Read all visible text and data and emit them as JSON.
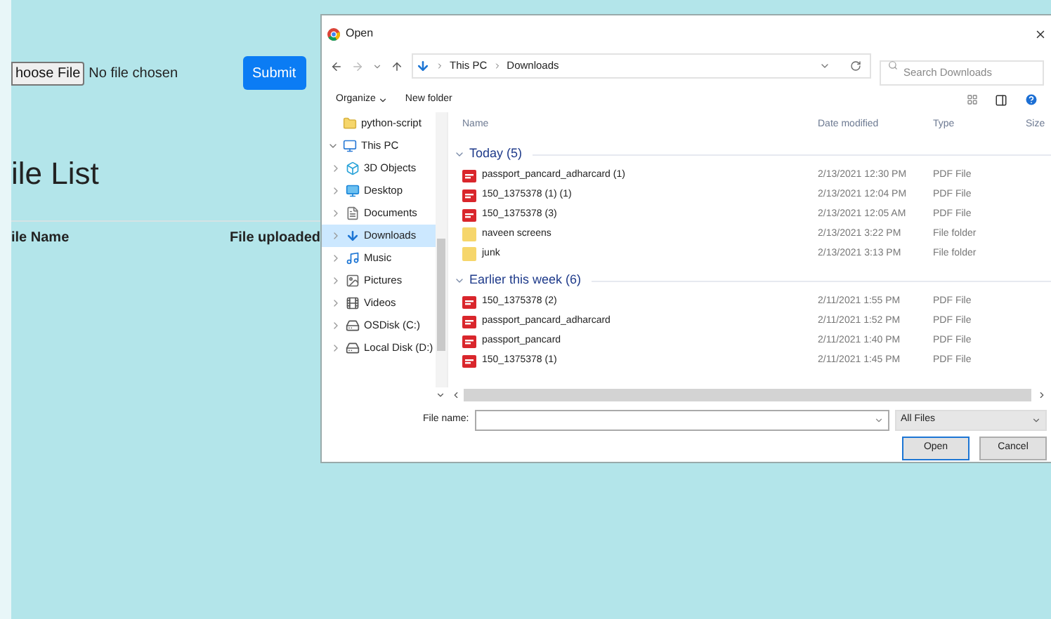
{
  "page": {
    "file_input": {
      "button": "hoose File",
      "status": "No file chosen"
    },
    "submit": "Submit",
    "heading": "ile List",
    "table": {
      "columns": [
        "ile Name",
        "File uploaded"
      ]
    }
  },
  "dialog": {
    "title": "Open",
    "address": {
      "path": [
        "This PC",
        "Downloads"
      ]
    },
    "search": {
      "placeholder": "Search Downloads"
    },
    "toolbar": {
      "organize": "Organize",
      "new_folder": "New folder"
    },
    "nav": [
      {
        "label": "python-script",
        "kind": "folder",
        "selected": false
      },
      {
        "label": "This PC",
        "kind": "pc",
        "selected": false,
        "expanded": true,
        "children": [
          {
            "label": "3D Objects",
            "kind": "objects",
            "selected": false
          },
          {
            "label": "Desktop",
            "kind": "desktop",
            "selected": false
          },
          {
            "label": "Documents",
            "kind": "documents",
            "selected": false
          },
          {
            "label": "Downloads",
            "kind": "downloads",
            "selected": true
          },
          {
            "label": "Music",
            "kind": "music",
            "selected": false
          },
          {
            "label": "Pictures",
            "kind": "pictures",
            "selected": false
          },
          {
            "label": "Videos",
            "kind": "videos",
            "selected": false
          },
          {
            "label": "OSDisk (C:)",
            "kind": "disk",
            "selected": false
          },
          {
            "label": "Local Disk (D:)",
            "kind": "disk",
            "selected": false
          }
        ]
      }
    ],
    "columns": [
      "Name",
      "Date modified",
      "Type",
      "Size"
    ],
    "groups": [
      {
        "label": "Today (5)",
        "expanded": true,
        "rows": [
          {
            "name": "passport_pancard_adharcard (1)",
            "date": "2/13/2021 12:30 PM",
            "type": "PDF File",
            "kind": "pdf"
          },
          {
            "name": "150_1375378 (1) (1)",
            "date": "2/13/2021 12:04 PM",
            "type": "PDF File",
            "kind": "pdf"
          },
          {
            "name": "150_1375378 (3)",
            "date": "2/13/2021 12:05 AM",
            "type": "PDF File",
            "kind": "pdf"
          },
          {
            "name": "naveen screens",
            "date": "2/13/2021 3:22 PM",
            "type": "File folder",
            "kind": "folder"
          },
          {
            "name": "junk",
            "date": "2/13/2021 3:13 PM",
            "type": "File folder",
            "kind": "folder"
          }
        ]
      },
      {
        "label": "Earlier this week (6)",
        "expanded": true,
        "rows": [
          {
            "name": "150_1375378 (2)",
            "date": "2/11/2021 1:55 PM",
            "type": "PDF File",
            "kind": "pdf"
          },
          {
            "name": "passport_pancard_adharcard",
            "date": "2/11/2021 1:52 PM",
            "type": "PDF File",
            "kind": "pdf"
          },
          {
            "name": "passport_pancard",
            "date": "2/11/2021 1:40 PM",
            "type": "PDF File",
            "kind": "pdf"
          },
          {
            "name": "150_1375378 (1)",
            "date": "2/11/2021 1:45 PM",
            "type": "PDF File",
            "kind": "pdf"
          }
        ]
      }
    ],
    "file_name": {
      "label": "File name:"
    },
    "filter": "All Files",
    "buttons": [
      {
        "label": "Open",
        "default": true
      },
      {
        "label": "Cancel",
        "default": false
      }
    ]
  }
}
